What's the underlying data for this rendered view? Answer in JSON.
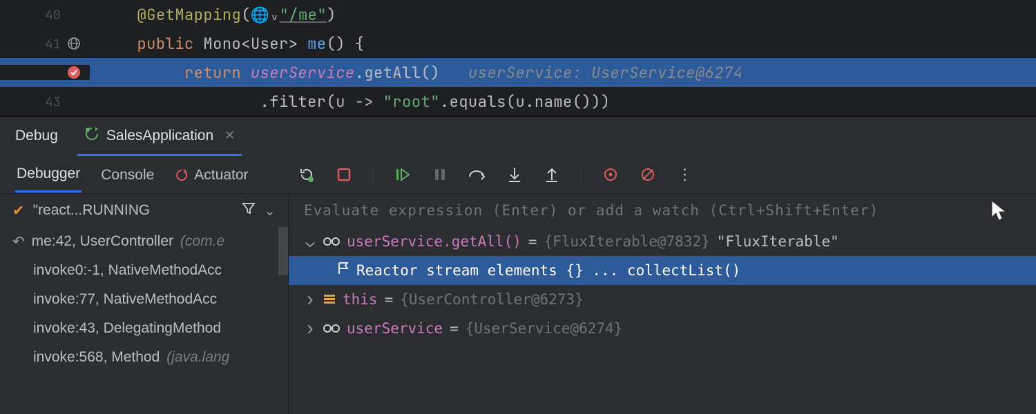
{
  "editor": {
    "lines": [
      {
        "num": "40"
      },
      {
        "num": "41"
      },
      {
        "num": ""
      },
      {
        "num": "43"
      }
    ],
    "l40": {
      "ann": "@GetMapping",
      "str": "\"/me\"",
      "close": ")"
    },
    "l41": {
      "kw1": "public ",
      "type": "Mono",
      "generic": "<",
      "cls": "User",
      "generic2": "> ",
      "mth": "me",
      "rest": "() {"
    },
    "l42": {
      "kw": "return ",
      "id": "userService",
      "call": ".getAll()",
      "inlay": "userService: UserService@6274"
    },
    "l43": {
      "code": ".filter(u -> ",
      "str": "\"root\"",
      "code2": ".equals(u.name()))"
    }
  },
  "debug": {
    "title": "Debug",
    "run_config": "SalesApplication",
    "tabs": {
      "debugger": "Debugger",
      "console": "Console",
      "actuator": "Actuator"
    },
    "thread": {
      "label": "\"react...RUNNING"
    },
    "frames": [
      {
        "main": "me:42, UserController ",
        "dim": "(com.e"
      },
      {
        "main": "invoke0:-1, NativeMethodAcc",
        "dim": ""
      },
      {
        "main": "invoke:77, NativeMethodAcc",
        "dim": ""
      },
      {
        "main": "invoke:43, DelegatingMethod",
        "dim": ""
      },
      {
        "main": "invoke:568, Method ",
        "dim": "(java.lang"
      }
    ],
    "eval_placeholder": "Evaluate expression (Enter) or add a watch (Ctrl+Shift+Enter)",
    "vars": {
      "v1": {
        "name": "userService.getAll()",
        "eq": " = ",
        "type": "{FluxIterable@7832}",
        "str": " \"FluxIterable\""
      },
      "v2": {
        "label": "Reactor stream elements {}  ... collectList()"
      },
      "v3": {
        "name": "this",
        "eq": " = ",
        "type": "{UserController@6273}"
      },
      "v4": {
        "name": "userService",
        "eq": " = ",
        "type": "{UserService@6274}"
      }
    }
  }
}
